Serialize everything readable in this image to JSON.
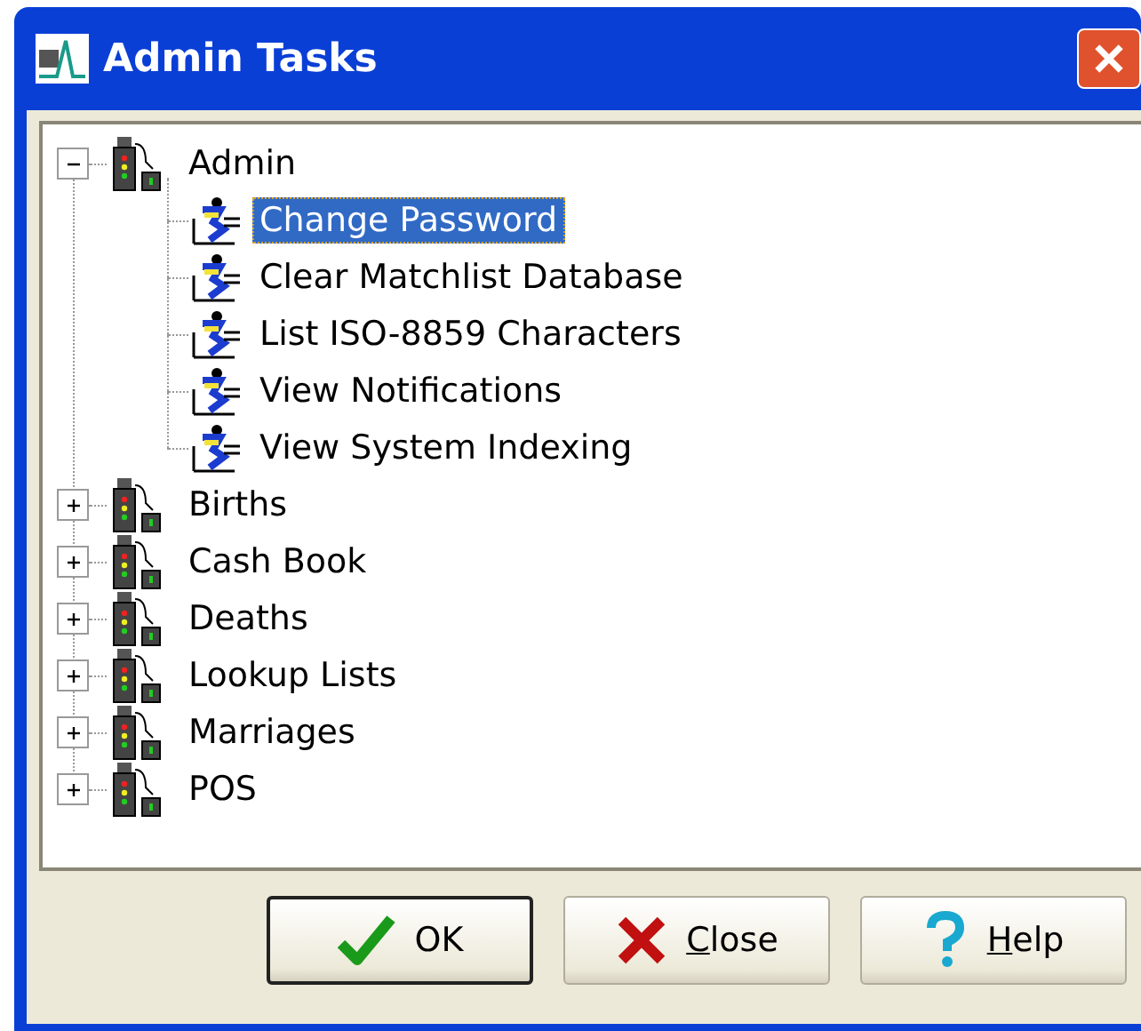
{
  "window": {
    "title": "Admin Tasks"
  },
  "tree": [
    {
      "label": "Admin",
      "kind": "group",
      "expanded": true,
      "selected": false,
      "children": [
        {
          "label": "Change Password",
          "kind": "task",
          "selected": true
        },
        {
          "label": "Clear Matchlist Database",
          "kind": "task",
          "selected": false
        },
        {
          "label": "List ISO-8859 Characters",
          "kind": "task",
          "selected": false
        },
        {
          "label": "View Notifications",
          "kind": "task",
          "selected": false
        },
        {
          "label": "View System Indexing",
          "kind": "task",
          "selected": false
        }
      ]
    },
    {
      "label": "Births",
      "kind": "group",
      "expanded": false,
      "selected": false
    },
    {
      "label": "Cash Book",
      "kind": "group",
      "expanded": false,
      "selected": false
    },
    {
      "label": "Deaths",
      "kind": "group",
      "expanded": false,
      "selected": false
    },
    {
      "label": "Lookup Lists",
      "kind": "group",
      "expanded": false,
      "selected": false
    },
    {
      "label": "Marriages",
      "kind": "group",
      "expanded": false,
      "selected": false
    },
    {
      "label": "POS",
      "kind": "group",
      "expanded": false,
      "selected": false
    }
  ],
  "buttons": [
    {
      "label": "OK",
      "kind": "ok",
      "default": true,
      "mnemonic_first": false
    },
    {
      "label": "Close",
      "kind": "close",
      "default": false,
      "mnemonic_first": true
    },
    {
      "label": "Help",
      "kind": "help",
      "default": false,
      "mnemonic_first": true
    }
  ]
}
